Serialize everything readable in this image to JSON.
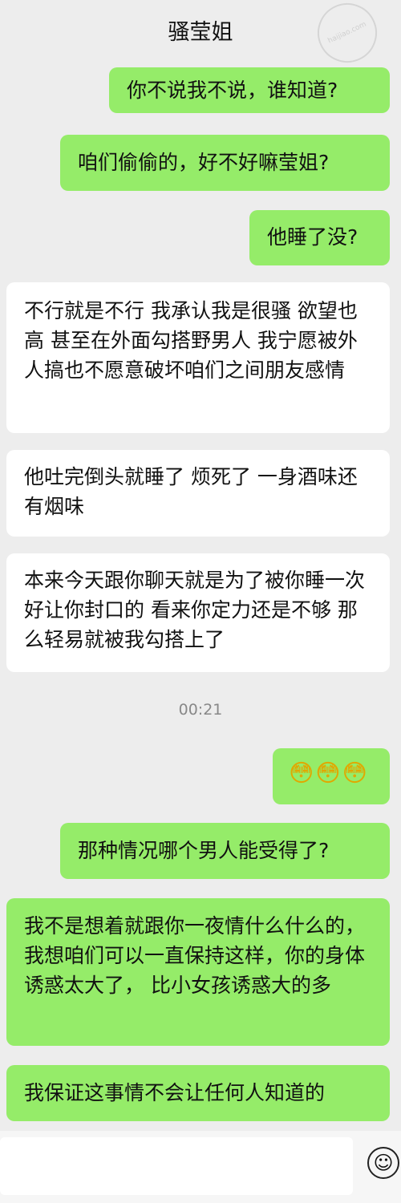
{
  "header": {
    "title": "骚莹姐",
    "watermark": "haijiao.com"
  },
  "messages": [
    {
      "side": "right",
      "text": "你不说我不说，谁知道?"
    },
    {
      "side": "right",
      "text": "咱们偷偷的，好不好嘛莹姐?"
    },
    {
      "side": "right",
      "text": "他睡了没?"
    },
    {
      "side": "left",
      "text": "不行就是不行 我承认我是很骚 欲望也高 甚至在外面勾搭野男人 我宁愿被外人搞也不愿意破坏咱们之间朋友感情"
    },
    {
      "side": "left",
      "text": "他吐完倒头就睡了 烦死了 一身酒味还有烟味"
    },
    {
      "side": "left",
      "text": "本来今天跟你聊天就是为了被你睡一次好让你封口的 看来你定力还是不够 那么轻易就被我勾搭上了"
    },
    {
      "side": "right",
      "emoji": [
        "😳",
        "😳",
        "😳"
      ]
    },
    {
      "side": "right",
      "text": "那种情况哪个男人能受得了?"
    },
    {
      "side": "right",
      "text": "我不是想着就跟你一夜情什么什么的， 我想咱们可以一直保持这样，你的身体诱惑太大了， 比小女孩诱惑大的多"
    },
    {
      "side": "right",
      "text": "我保证这事情不会让任何人知道的"
    }
  ],
  "timestamp": "00:21",
  "input": {
    "placeholder": "",
    "emoji_icon": "smiley-icon"
  },
  "colors": {
    "background": "#ededed",
    "sent_bubble": "#95ec69",
    "received_bubble": "#ffffff"
  }
}
